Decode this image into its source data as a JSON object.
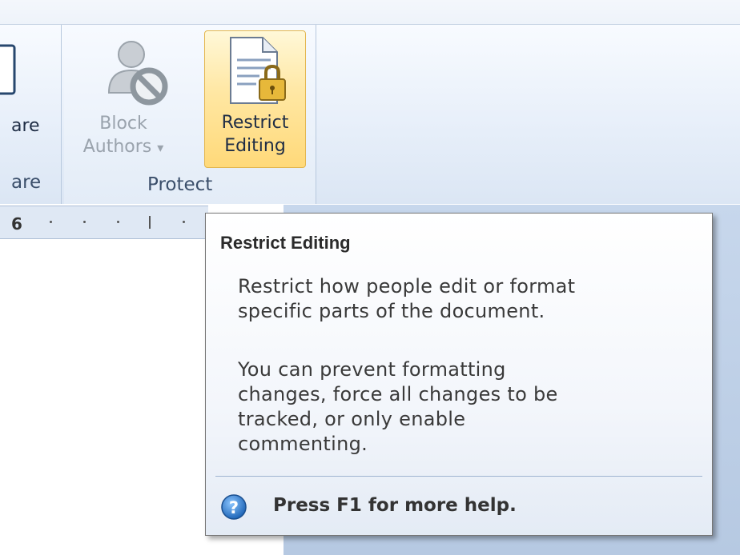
{
  "ribbon": {
    "left_group": {
      "button_label_fragment": "are",
      "group_label_fragment": "are"
    },
    "protect_group": {
      "group_label": "Protect",
      "block_authors": {
        "label_line1": "Block",
        "label_line2": "Authors",
        "dropdown_glyph": "▾",
        "icon": "block-authors-icon",
        "enabled": false
      },
      "restrict_editing": {
        "label_line1": "Restrict",
        "label_line2": "Editing",
        "icon": "document-lock-icon",
        "state": "hover"
      }
    }
  },
  "ruler": {
    "number": "6"
  },
  "tooltip": {
    "title": "Restrict Editing",
    "description_line1": "Restrict how people edit or format",
    "description_line2": "specific parts of the document.",
    "detail_line1": "You can prevent formatting",
    "detail_line2": "changes, force all changes to be",
    "detail_line3": "tracked, or only enable",
    "detail_line4": "commenting.",
    "help_text": "Press F1 for more help.",
    "help_icon": "help-icon"
  },
  "colors": {
    "ribbon_bg": "#e6eef9",
    "hover_highlight": "#ffd979",
    "help_icon_blue": "#2f7fd0"
  }
}
